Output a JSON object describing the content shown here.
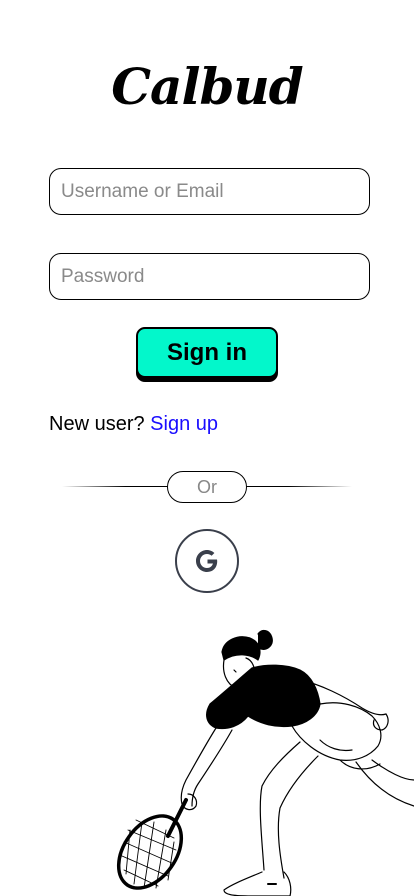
{
  "app": {
    "logo_text": "Calbud"
  },
  "form": {
    "username_placeholder": "Username or Email",
    "password_placeholder": "Password",
    "signin_label": "Sign in"
  },
  "signup": {
    "prompt": "New user?",
    "link_label": "Sign up"
  },
  "divider": {
    "label": "Or"
  },
  "social": {
    "google_icon": "google-g-icon"
  },
  "colors": {
    "accent": "#03f7cb",
    "link": "#1a0dff",
    "placeholder": "#8a8a8a"
  }
}
